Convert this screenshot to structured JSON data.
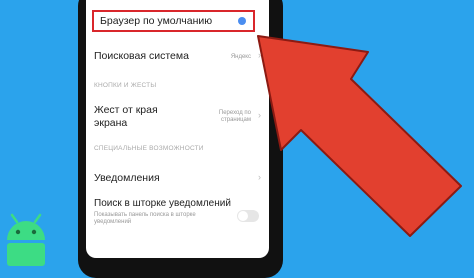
{
  "settings": {
    "default_browser": {
      "label": "Браузер по умолчанию"
    },
    "search_engine": {
      "label": "Поисковая система",
      "value": "Яндекс"
    },
    "section_buttons": "КНОПКИ И ЖЕСТЫ",
    "edge_gesture": {
      "label_line1": "Жест от края",
      "label_line2": "экрана",
      "value_line1": "Переход по",
      "value_line2": "страницам"
    },
    "section_special": "СПЕЦИАЛЬНЫЕ ВОЗМОЖНОСТИ",
    "notifications": {
      "label": "Уведомления"
    },
    "search_in_shade": {
      "label": "Поиск в шторке уведомлений",
      "sub_line1": "Показывать панель поиска в шторке",
      "sub_line2": "уведомлений"
    }
  },
  "colors": {
    "background": "#2ba3ec",
    "highlight_border": "#d9262b",
    "arrow": "#e2402f",
    "accent_dot": "#4a8df0",
    "android_green": "#3ddc84"
  },
  "icons": [
    "chevron-right-icon",
    "android-logo-icon",
    "pointer-arrow-icon"
  ]
}
